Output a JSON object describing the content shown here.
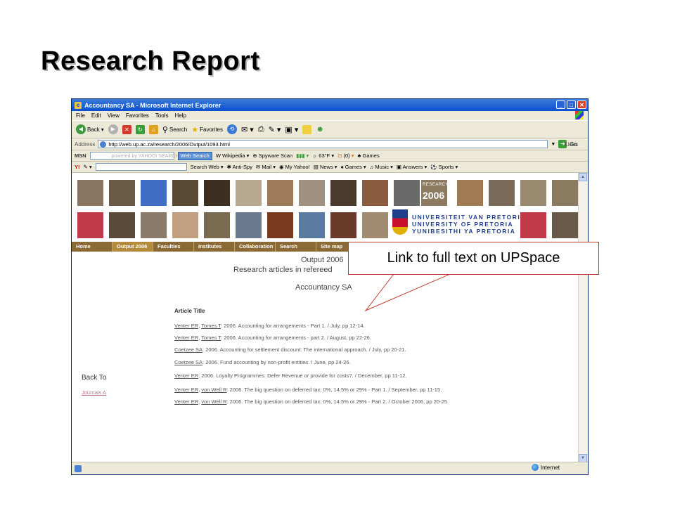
{
  "slide": {
    "title": "Research Report"
  },
  "callout": {
    "text": "Link to full text on UPSpace"
  },
  "browser": {
    "title": "Accountancy SA - Microsoft Internet Explorer",
    "menu": [
      "File",
      "Edit",
      "View",
      "Favorites",
      "Tools",
      "Help"
    ],
    "toolbar": {
      "back": "Back",
      "search": "Search",
      "favorites": "Favorites"
    },
    "address": {
      "label": "Address",
      "url": "http://web.up.ac.za/research/2006/Output/1093.html",
      "go": "Go",
      "links": "Links"
    },
    "msn_toolbar": {
      "logo": "MSN",
      "placeholder": "powered by YAHOO! SEARCH",
      "web_search": "Web Search",
      "wikipedia": "Wikipedia",
      "spyware": "Spyware Scan",
      "weather": "63°F",
      "mail_count": "(0)",
      "games": "Games"
    },
    "yahoo_toolbar": {
      "search_web": "Search Web",
      "anti_spy": "Anti-Spy",
      "mail": "Mail",
      "my_yahoo": "My Yahoo!",
      "news": "News",
      "games": "Games",
      "music": "Music",
      "answers": "Answers",
      "sports": "Sports"
    },
    "status": {
      "zone": "Internet"
    }
  },
  "banner": {
    "badge_line1": "RESEARCH",
    "badge_line2": "2006",
    "university_lines": [
      "UNIVERSITEIT VAN PRETORIA",
      "UNIVERSITY OF PRETORIA",
      "YUNIBESITHI YA PRETORIA"
    ]
  },
  "site_nav": [
    "Home",
    "Output 2006",
    "Faculties",
    "Institutes",
    "Collaboration",
    "Search",
    "Site map"
  ],
  "page": {
    "heading": "Output 2006",
    "subheading": "Research articles in refereed",
    "journal": "Accountancy SA",
    "column_header": "Article Title",
    "back_to": "Back To",
    "journals_link": "Journals A",
    "articles": [
      {
        "authors": [
          "Venter ER",
          "Tomes T"
        ],
        "text": ": 2006. Accounting for arrangements - Part 1. / July, pp 12-14."
      },
      {
        "authors": [
          "Venter ER",
          "Tomes T"
        ],
        "text": ": 2006. Accounting for arrangements - part 2. / August, pp 22-26."
      },
      {
        "authors": [
          "Coetzee SA"
        ],
        "text": ": 2006. Accounting for settlement discount: The international approach. / July, pp 20-21."
      },
      {
        "authors": [
          "Coetzee SA"
        ],
        "text": ": 2006. Fund accounting by non-profit entities. / June, pp 24-26."
      },
      {
        "authors": [
          "Venter ER"
        ],
        "text": ": 2006. Loyalty Programmes: Defer Revenue or provide for costs?. / December, pp 11-12."
      },
      {
        "authors": [
          "Venter ER",
          "von Well R"
        ],
        "text": ": 2006. The big question on deferred tax: 0%, 14.5% or 29% - Part 1. / September, pp 11-15."
      },
      {
        "authors": [
          "Venter ER",
          "von Well R"
        ],
        "text": ": 2006. The big question on deferred tax: 0%, 14.5% or 29% - Part 2. / October 2006, pp 20-25."
      }
    ]
  },
  "colors": {
    "nav_bg": "#8b6a36",
    "callout_border": "#c0392b",
    "up_blue": "#1f3f8c"
  }
}
